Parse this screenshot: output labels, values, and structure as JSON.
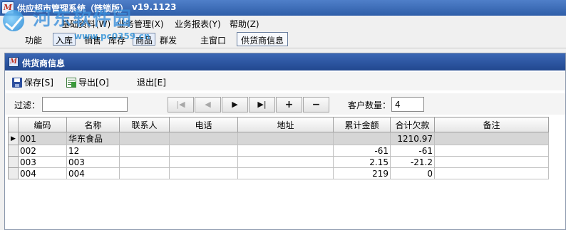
{
  "app": {
    "title": "供应超市管理系统（链锁版）",
    "version": "v19.1123"
  },
  "watermark": {
    "title": "河东软件园",
    "url": "www.pc0359.cn"
  },
  "menu": {
    "items": [
      {
        "label": "基础资料(W)"
      },
      {
        "label": "业务管理(X)"
      },
      {
        "label": "业务报表(Y)"
      },
      {
        "label": "帮助(Z)"
      }
    ]
  },
  "toolbar": {
    "function_label": "功能",
    "stock_in_label": "入库",
    "sales_label": "销售",
    "inventory_label": "库存",
    "goods_label": "商品",
    "wholesale_label": "群发",
    "tabs": [
      {
        "label": "主窗口"
      },
      {
        "label": "供货商信息"
      }
    ]
  },
  "window": {
    "title": "供货商信息",
    "actions": {
      "save_label": "保存[S]",
      "export_label": "导出[O]",
      "exit_label": "退出[E]"
    },
    "filter": {
      "label": "过滤：",
      "value": ""
    },
    "navigator": {
      "first": "|◀",
      "prev": "◀",
      "next": "▶",
      "last": "▶|",
      "add": "+",
      "delete": "−"
    },
    "count": {
      "label": "客户数量：",
      "value": "4"
    }
  },
  "grid": {
    "columns": [
      "编码",
      "名称",
      "联系人",
      "电话",
      "地址",
      "累计金额",
      "合计欠款",
      "备注"
    ],
    "rows": [
      {
        "code": "001",
        "name": "华东食品",
        "contact": "",
        "phone": "",
        "address": "",
        "total": "",
        "debt": "1210.97",
        "remark": "",
        "selected": true
      },
      {
        "code": "002",
        "name": "12",
        "contact": "",
        "phone": "",
        "address": "",
        "total": "-61",
        "debt": "-61",
        "remark": ""
      },
      {
        "code": "003",
        "name": "003",
        "contact": "",
        "phone": "",
        "address": "",
        "total": "2.15",
        "debt": "-21.2",
        "remark": ""
      },
      {
        "code": "004",
        "name": "004",
        "contact": "",
        "phone": "",
        "address": "",
        "total": "219",
        "debt": "0",
        "remark": ""
      }
    ]
  }
}
